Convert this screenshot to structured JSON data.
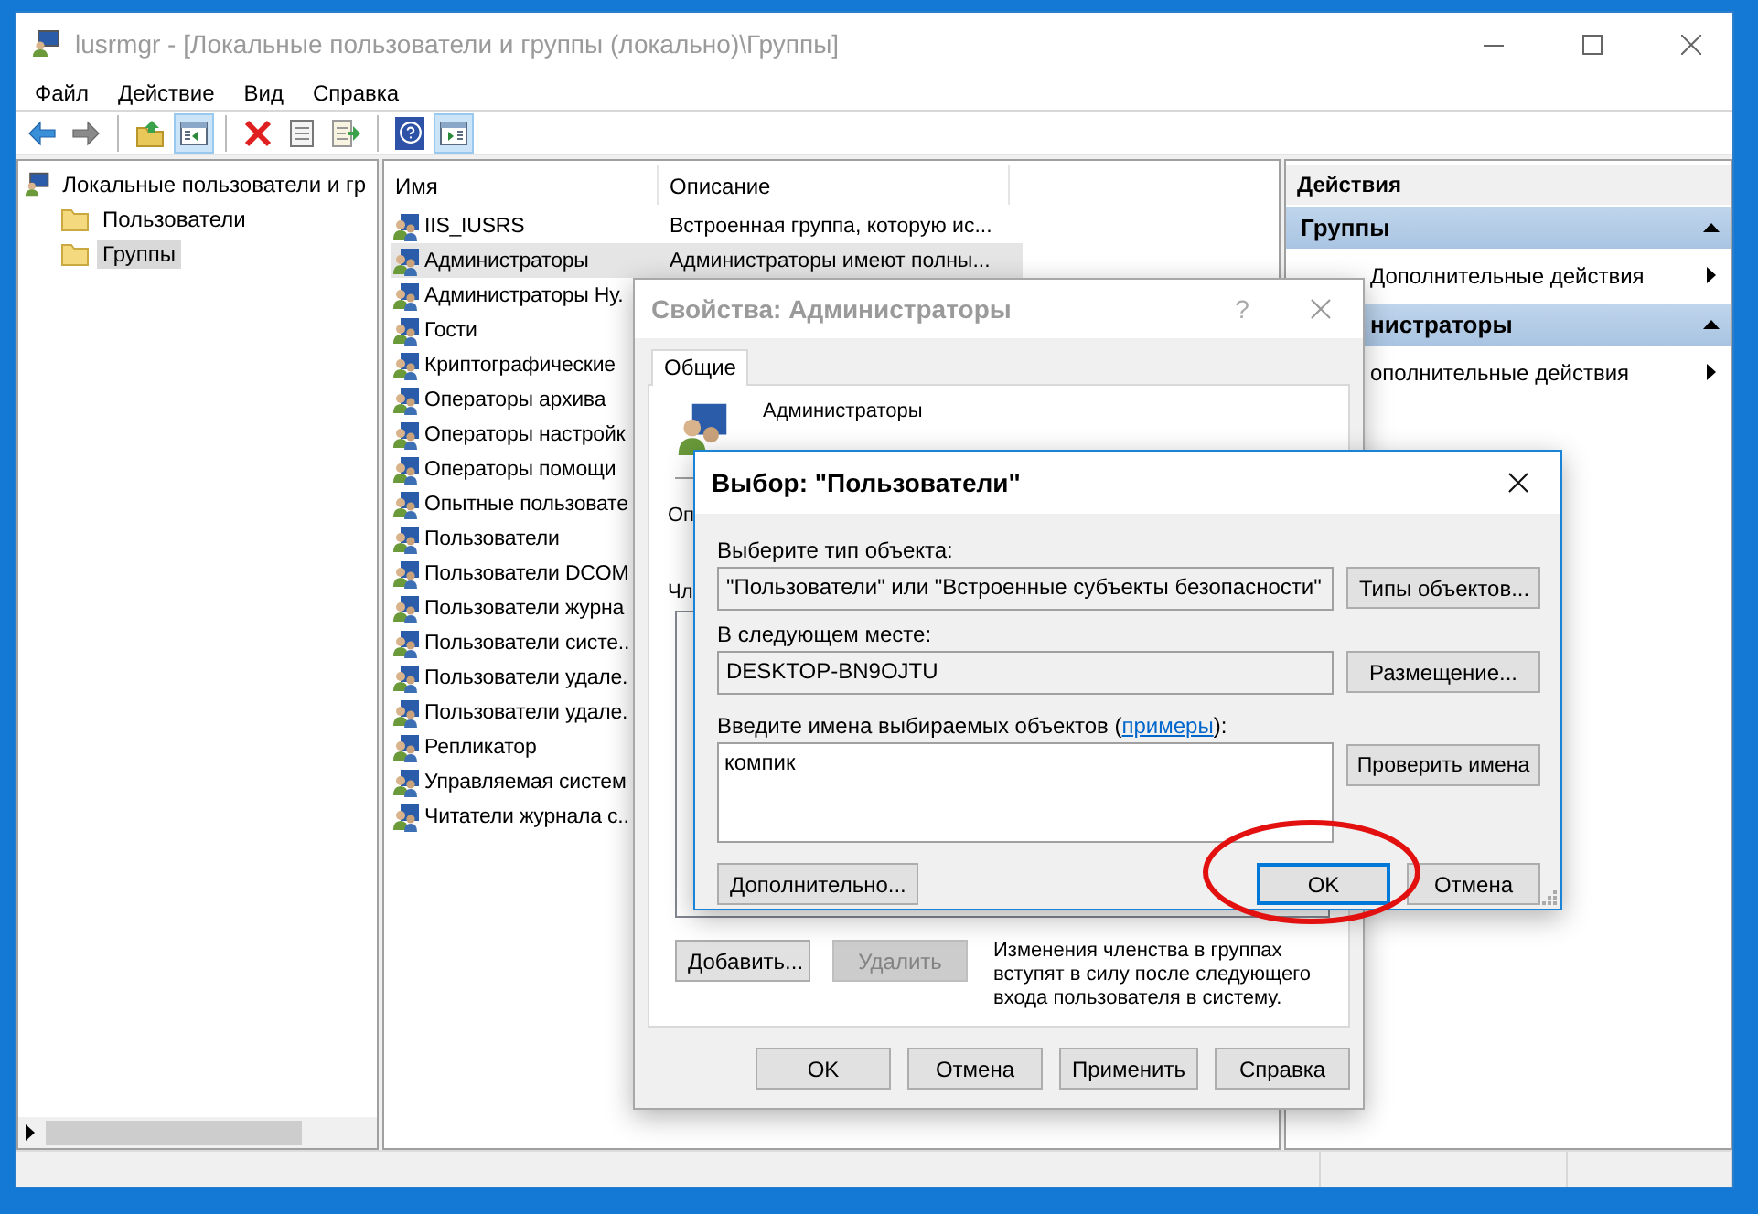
{
  "window": {
    "title": "lusrmgr - [Локальные пользователи и группы (локально)\\Группы]"
  },
  "menu": [
    "Файл",
    "Действие",
    "Вид",
    "Справка"
  ],
  "toolbar": [
    {
      "kind": "back",
      "pressed": false
    },
    {
      "kind": "forward",
      "pressed": false
    },
    {
      "kind": "separator"
    },
    {
      "kind": "up",
      "pressed": false
    },
    {
      "kind": "tree",
      "pressed": true
    },
    {
      "kind": "separator"
    },
    {
      "kind": "delete",
      "pressed": false
    },
    {
      "kind": "properties",
      "pressed": false
    },
    {
      "kind": "export",
      "pressed": false
    },
    {
      "kind": "separator"
    },
    {
      "kind": "help",
      "pressed": false
    },
    {
      "kind": "actionpane",
      "pressed": true
    }
  ],
  "tree": {
    "label": "Локальные пользователи и гр",
    "children": [
      {
        "label": "Пользователи",
        "selected": false
      },
      {
        "label": "Группы",
        "selected": true
      }
    ]
  },
  "list": {
    "columns": [
      "Имя",
      "Описание"
    ],
    "rows": [
      {
        "name": "IIS_IUSRS",
        "description": "Встроенная группа, которую ис...",
        "selected": false
      },
      {
        "name": "Администраторы",
        "description": "Администраторы имеют полны...",
        "selected": true
      },
      {
        "name": "Администраторы Ну.",
        "selected": false
      },
      {
        "name": "Гости",
        "selected": false
      },
      {
        "name": "Криптографические",
        "selected": false
      },
      {
        "name": "Операторы архива",
        "selected": false
      },
      {
        "name": "Операторы настройк",
        "selected": false
      },
      {
        "name": "Операторы помощи",
        "selected": false
      },
      {
        "name": "Опытные пользовате",
        "selected": false
      },
      {
        "name": "Пользователи",
        "selected": false
      },
      {
        "name": "Пользователи DCOM",
        "selected": false
      },
      {
        "name": "Пользователи журна",
        "selected": false
      },
      {
        "name": "Пользователи систе..",
        "selected": false
      },
      {
        "name": "Пользователи удале.",
        "selected": false
      },
      {
        "name": "Пользователи удале.",
        "selected": false
      },
      {
        "name": "Репликатор",
        "selected": false
      },
      {
        "name": "Управляемая систем",
        "selected": false
      },
      {
        "name": "Читатели журнала с..",
        "selected": false
      }
    ]
  },
  "actions": {
    "title": "Действия",
    "sections": [
      {
        "title": "Группы",
        "expanded": true,
        "items": [
          "Дополнительные действия"
        ]
      },
      {
        "title": "нистраторы",
        "expanded": true,
        "items": [
          "ополнительные действия"
        ]
      }
    ]
  },
  "properties_dialog": {
    "title": "Свойства: Администраторы",
    "help": "?",
    "tabs": [
      {
        "label": "Общие",
        "selected": true
      }
    ],
    "group_name": "Администраторы",
    "description_label": "Оп",
    "members_label": "Чл",
    "add_button": {
      "label": "Добавить...",
      "disabled": false
    },
    "remove_button": {
      "label": "Удалить",
      "disabled": true
    },
    "note": "Изменения членства в группах вступят в силу после следующего входа пользователя в систему.",
    "buttons": [
      "OK",
      "Отмена",
      "Применить",
      "Справка"
    ]
  },
  "select_dialog": {
    "title": "Выбор: \"Пользователи\"",
    "type_label": "Выберите тип объекта:",
    "type_value": "\"Пользователи\" или \"Встроенные субъекты безопасности\"",
    "type_button": "Типы объектов...",
    "location_label": "В следующем месте:",
    "location_value": "DESKTOP-BN9OJTU",
    "location_button": "Размещение...",
    "names_label_before": "Введите имена выбираемых объектов (",
    "names_link": "примеры",
    "names_label_after": "):",
    "names_value": "компик",
    "check_button": "Проверить имена",
    "advanced_button": "Дополнительно...",
    "ok_button": {
      "label": "OK",
      "default": true
    },
    "cancel_button": "Отмена"
  }
}
